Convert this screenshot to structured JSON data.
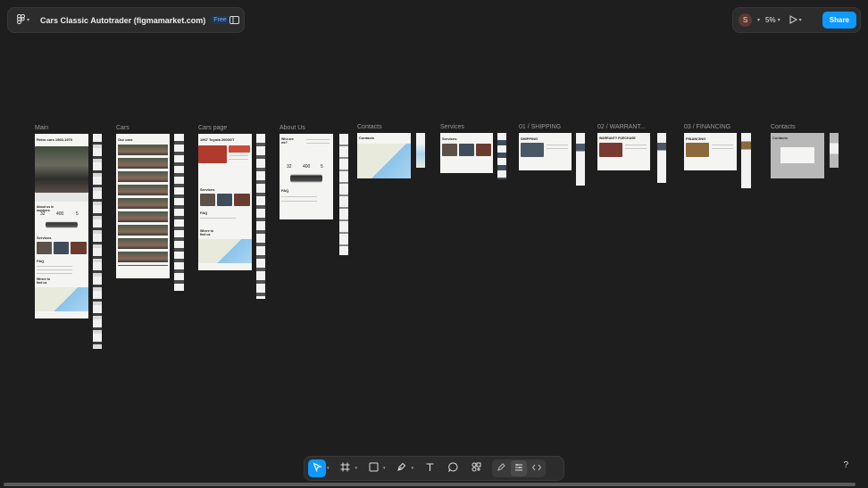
{
  "app": {
    "file_title": "Cars Classic Autotrader (figmamarket.com)",
    "plan_badge": "Free",
    "user_initial": "S",
    "zoom": "5%",
    "share_label": "Share",
    "help_label": "?"
  },
  "frames": [
    {
      "label": "Main",
      "heading": "Retro cars 1960-1970"
    },
    {
      "label": "Cars",
      "heading": "Our cars"
    },
    {
      "label": "Cars page",
      "heading": "1967 Toyota 2000GT"
    },
    {
      "label": "About Us",
      "heading": "Who are we?"
    },
    {
      "label": "Contacts",
      "heading": "Contacts"
    },
    {
      "label": "Services",
      "heading": "Services"
    },
    {
      "label": "01 / SHIPPING",
      "heading": "SHIPPING"
    },
    {
      "label": "02 / WARRANT...",
      "heading": "WARRANTY PURCHASE"
    },
    {
      "label": "03 / FINANCING",
      "heading": "FINANCING"
    },
    {
      "label": "Contacts",
      "heading": "Contacts"
    }
  ],
  "main_frame_text": {
    "about": "About us in numbers",
    "stat_1": "32",
    "stat_2": "400",
    "stat_3": "5",
    "services": "Services",
    "faq": "FAQ",
    "where": "Where to find us"
  },
  "about_frame_text": {
    "stat_1": "32",
    "stat_2": "400",
    "stat_3": "5",
    "faq": "FAQ"
  },
  "cars_page_text": {
    "services": "Services",
    "faq": "FAQ",
    "where": "Where to find us"
  },
  "toolbar": {
    "tools": [
      "move-tool",
      "frame-tool",
      "shape-tool",
      "pen-tool",
      "text-tool",
      "comment-tool",
      "actions-tool"
    ],
    "modes": [
      "draw-mode",
      "design-mode",
      "dev-mode"
    ]
  }
}
